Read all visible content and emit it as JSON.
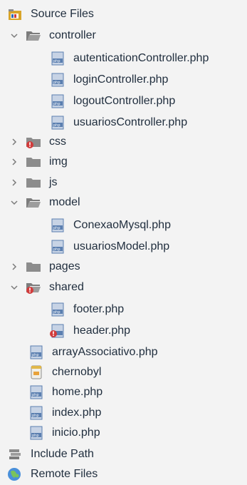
{
  "tree": {
    "source_files": {
      "label": "Source Files",
      "icon": "source-files-icon"
    },
    "controller": {
      "label": "controller",
      "icon": "folder-open-icon",
      "expanded": true,
      "children": [
        {
          "label": "autenticationController.php",
          "icon": "php-file-icon"
        },
        {
          "label": "loginController.php",
          "icon": "php-file-icon"
        },
        {
          "label": "logoutController.php",
          "icon": "php-file-icon"
        },
        {
          "label": "usuariosController.php",
          "icon": "php-file-icon"
        }
      ]
    },
    "css": {
      "label": "css",
      "icon": "folder-error-icon",
      "expanded": false
    },
    "img": {
      "label": "img",
      "icon": "folder-icon",
      "expanded": false
    },
    "js": {
      "label": "js",
      "icon": "folder-icon",
      "expanded": false
    },
    "model": {
      "label": "model",
      "icon": "folder-open-icon",
      "expanded": true,
      "children": [
        {
          "label": "ConexaoMysql.php",
          "icon": "php-file-icon"
        },
        {
          "label": "usuariosModel.php",
          "icon": "php-file-icon"
        }
      ]
    },
    "pages": {
      "label": "pages",
      "icon": "folder-icon",
      "expanded": false
    },
    "shared": {
      "label": "shared",
      "icon": "folder-open-error-icon",
      "expanded": true,
      "children": [
        {
          "label": "footer.php",
          "icon": "php-file-icon"
        },
        {
          "label": "header.php",
          "icon": "php-file-error-icon"
        }
      ]
    },
    "root_files": [
      {
        "label": "arrayAssociativo.php",
        "icon": "php-file-icon"
      },
      {
        "label": "chernobyl",
        "icon": "generic-file-icon"
      },
      {
        "label": "home.php",
        "icon": "php-file-icon"
      },
      {
        "label": "index.php",
        "icon": "php-file-icon"
      },
      {
        "label": "inicio.php",
        "icon": "php-file-icon"
      }
    ],
    "include_path": {
      "label": "Include Path",
      "icon": "include-path-icon"
    },
    "remote_files": {
      "label": "Remote Files",
      "icon": "globe-icon"
    }
  },
  "colors": {
    "folder": "#8c8c8c",
    "php_blue": "#5b7fb0",
    "error_red": "#d23b3b",
    "text": "#1f2d3d"
  }
}
